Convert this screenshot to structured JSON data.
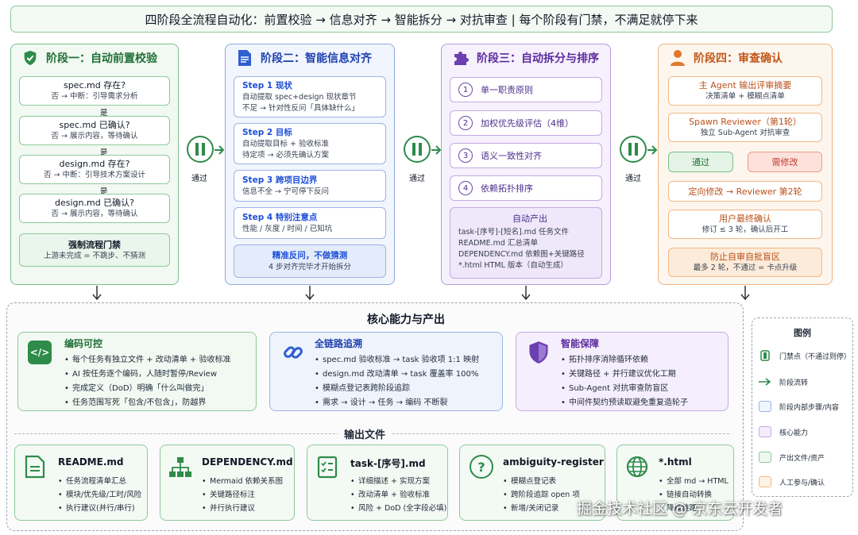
{
  "title": "四阶段全流程自动化：前置校验 → 信息对齐 → 智能拆分 → 对抗审查 | 每个阶段有门禁，不满足就停下来",
  "stage1": {
    "title": "阶段一：自动前置校验",
    "checks": [
      {
        "q": "spec.md 存在?",
        "a": "否 → 中断：引导需求分析"
      },
      {
        "q": "spec.md 已确认?",
        "a": "否 → 展示内容，等待确认"
      },
      {
        "q": "design.md 存在?",
        "a": "否 → 中断：引导技术方案设计"
      },
      {
        "q": "design.md 已确认?",
        "a": "否 → 展示内容，等待确认"
      }
    ],
    "yes": "是",
    "gate_title": "强制流程门禁",
    "gate_sub": "上游未完成 = 不跳步、不猜测"
  },
  "stage2": {
    "title": "阶段二：智能信息对齐",
    "steps": [
      {
        "t": "Step 1 现状",
        "l1": "自动提取 spec+design 现状章节",
        "l2": "不足 → 针对性反问「具体缺什么」"
      },
      {
        "t": "Step 2 目标",
        "l1": "自动提取目标 + 验收标准",
        "l2": "待定项 → 必须先确认方案"
      },
      {
        "t": "Step 3 跨项目边界",
        "l1": "信息不全 → 宁可停下反问",
        "l2": ""
      },
      {
        "t": "Step 4 特别注意点",
        "l1": "性能 / 灰度 / 时间 / 已知坑",
        "l2": ""
      }
    ],
    "foot_title": "精准反问，不做猜测",
    "foot_sub": "4 步对齐完毕才开始拆分"
  },
  "stage3": {
    "title": "阶段三：自动拆分与排序",
    "items": [
      "单一职责原则",
      "加权优先级评估（4维）",
      "语义一致性对齐",
      "依赖拓扑排序"
    ],
    "nums": [
      "1",
      "2",
      "3",
      "4"
    ],
    "out_title": "自动产出",
    "outs": [
      "task-[序号]-[短名].md 任务文件",
      "README.md 汇总清单",
      "DEPENDENCY.md 依赖图+关键路径",
      "*.html HTML 版本（自动生成）"
    ]
  },
  "stage4": {
    "title": "阶段四：审查确认",
    "c1t": "主 Agent 输出评审摘要",
    "c1s": "决策清单 + 模糊点清单",
    "c2t": "Spawn Reviewer（第1轮）",
    "c2s": "独立 Sub-Agent 对抗审查",
    "pass": "通过",
    "fix": "需修改",
    "c3t": "定向修改 → Reviewer 第2轮",
    "c4t": "用户最终确认",
    "c4s": "修订 ≤ 3 轮，确认后开工",
    "c5t": "防止自审自批盲区",
    "c5s": "最多 2 轮，不通过 = 卡点升级"
  },
  "gate_label": "通过",
  "core": {
    "title": "核心能力与产出",
    "caps": [
      {
        "title": "编码可控",
        "items": [
          "每个任务有独立文件 + 改动清单 + 验收标准",
          "AI 按任务逐个编码，人随时暂停/Review",
          "完成定义（DoD）明确「什么叫做完」",
          "任务范围写死「包含/不包含」，防越界"
        ]
      },
      {
        "title": "全链路追溯",
        "items": [
          "spec.md 验收标准 → task 验收项 1:1 映射",
          "design.md 改动清单 → task 覆盖率 100%",
          "模糊点登记表跨阶段追踪",
          "需求 → 设计 → 任务 → 编码 不断裂"
        ]
      },
      {
        "title": "智能保障",
        "items": [
          "拓扑排序消除循环依赖",
          "关键路径 + 并行建议优化工期",
          "Sub-Agent 对抗审查防盲区",
          "中间件契约预读取避免重复造轮子"
        ]
      }
    ]
  },
  "outputs": {
    "title": "输出文件",
    "files": [
      {
        "name": "README.md",
        "items": [
          "任务流程清单汇总",
          "模块/优先级/工时/风险",
          "执行建议(并行/串行)"
        ]
      },
      {
        "name": "DEPENDENCY.md",
        "items": [
          "Mermaid 依赖关系图",
          "关键路径标注",
          "并行执行建议"
        ]
      },
      {
        "name": "task-[序号].md",
        "items": [
          "详细描述 + 实现方案",
          "改动清单 + 验收标准",
          "风险 + DoD (全字段必填)"
        ]
      },
      {
        "name": "ambiguity-register",
        "items": [
          "模糊点登记表",
          "跨阶段追踪 open 项",
          "新增/关闭记录"
        ]
      },
      {
        "name": "*.html",
        "items": [
          "全部 md → HTML",
          "链接自动转换",
          "降级链路"
        ]
      }
    ]
  },
  "legend": {
    "title": "图例",
    "items": [
      "门禁点（不通过则停）",
      "阶段流转",
      "阶段内部步骤/内容",
      "核心能力",
      "产出文件/资产",
      "人工参与/确认"
    ]
  },
  "watermark": "掘金技术社区 @ 京东云开发者",
  "colors": {
    "green": "#2e8b4a",
    "blue": "#2f5fd0",
    "purple": "#6b3fb0",
    "orange": "#e0782a"
  }
}
